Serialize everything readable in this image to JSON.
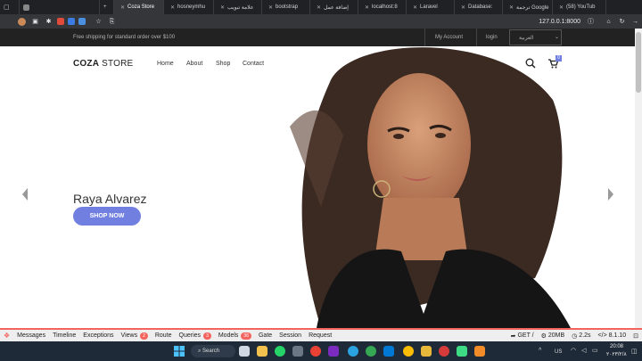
{
  "browser": {
    "tabs": [
      {
        "label": "",
        "active": false
      },
      {
        "label": "Coza Store",
        "active": true
      },
      {
        "label": "hosneymhu",
        "active": false
      },
      {
        "label": "علامة تبويب",
        "active": false
      },
      {
        "label": "bootstrap",
        "active": false
      },
      {
        "label": "إضافة عمل",
        "active": false
      },
      {
        "label": "localhost:8",
        "active": false
      },
      {
        "label": "Laravel",
        "active": false
      },
      {
        "label": "Database:",
        "active": false
      },
      {
        "label": "ترجمة Google",
        "active": false
      },
      {
        "label": "(58) YouTub",
        "active": false
      }
    ],
    "url": "127.0.0.1:8000"
  },
  "site": {
    "topbar": {
      "shipping": "Free shipping for standard order over $100",
      "my_account": "My Account",
      "login": "login",
      "language": "العربية"
    },
    "logo_bold": "COZA",
    "logo_light": " STORE",
    "nav": [
      "Home",
      "About",
      "Shop",
      "Contact"
    ],
    "cart_count": "0",
    "hero": {
      "title": "Raya Alvarez",
      "button": "SHOP NOW"
    }
  },
  "debugbar": {
    "items": [
      {
        "label": "Messages",
        "badge": ""
      },
      {
        "label": "Timeline",
        "badge": ""
      },
      {
        "label": "Exceptions",
        "badge": ""
      },
      {
        "label": "Views",
        "badge": "2"
      },
      {
        "label": "Route",
        "badge": ""
      },
      {
        "label": "Queries",
        "badge": "3"
      },
      {
        "label": "Models",
        "badge": "36"
      },
      {
        "label": "Gate",
        "badge": ""
      },
      {
        "label": "Session",
        "badge": ""
      },
      {
        "label": "Request",
        "badge": ""
      }
    ],
    "method": "GET /",
    "memory": "20MB",
    "time": "2.2s",
    "version": "8.1.10"
  },
  "taskbar": {
    "search": "Search",
    "lang": "US",
    "clock_time": "20:08",
    "clock_date": "٢٠٢٣/٢/٨"
  },
  "colors": {
    "accent": "#717fe0",
    "debug_accent": "#f4645f"
  }
}
